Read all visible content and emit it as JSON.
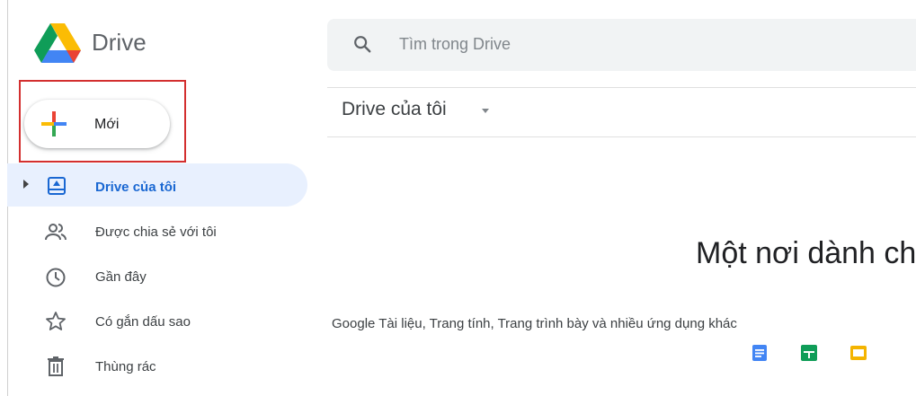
{
  "header": {
    "brand": "Drive",
    "search_placeholder": "Tìm trong Drive"
  },
  "sidebar": {
    "new_label": "Mới",
    "items": [
      {
        "label": "Drive của tôi",
        "icon": "my-drive-icon",
        "active": true
      },
      {
        "label": "Được chia sẻ với tôi",
        "icon": "shared-people-icon",
        "active": false
      },
      {
        "label": "Gần đây",
        "icon": "clock-icon",
        "active": false
      },
      {
        "label": "Có gắn dấu sao",
        "icon": "star-icon",
        "active": false
      },
      {
        "label": "Thùng rác",
        "icon": "trash-icon",
        "active": false
      }
    ]
  },
  "main": {
    "breadcrumb": "Drive của tôi",
    "hero_text": "Một nơi dành cho tất cả các tệp của bạn",
    "subtitle": "Google Tài liệu, Trang tính, Trang trình bày và nhiều ứng dụng khác",
    "apps": [
      "docs-icon",
      "sheets-icon",
      "slides-icon"
    ]
  },
  "colors": {
    "accent": "#1967d2",
    "active_bg": "#e8f0fe",
    "highlight_border": "#d32f2f",
    "docs": "#4285f4",
    "sheets": "#0f9d58",
    "slides": "#f4b400"
  }
}
